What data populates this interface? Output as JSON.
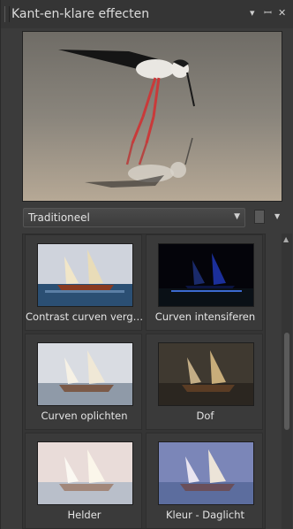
{
  "panel": {
    "title": "Kant-en-klare effecten",
    "menu_icon": "dropdown-arrow-icon",
    "pin_icon": "pin-icon",
    "close_icon": "close-icon"
  },
  "preview": {
    "subject": "black-winged stilt standing in water with reflection"
  },
  "category_select": {
    "selected": "Traditioneel"
  },
  "effects": [
    {
      "label": "Contrast curven verg…",
      "style": "contrast"
    },
    {
      "label": "Curven intensiferen",
      "style": "intense"
    },
    {
      "label": "Curven oplichten",
      "style": "brighten"
    },
    {
      "label": "Dof",
      "style": "dull"
    },
    {
      "label": "Helder",
      "style": "clear"
    },
    {
      "label": "Kleur - Daglicht",
      "style": "daylight"
    }
  ],
  "colors": {
    "panel_bg": "#3b3b3b",
    "text": "#e4e4e4"
  }
}
